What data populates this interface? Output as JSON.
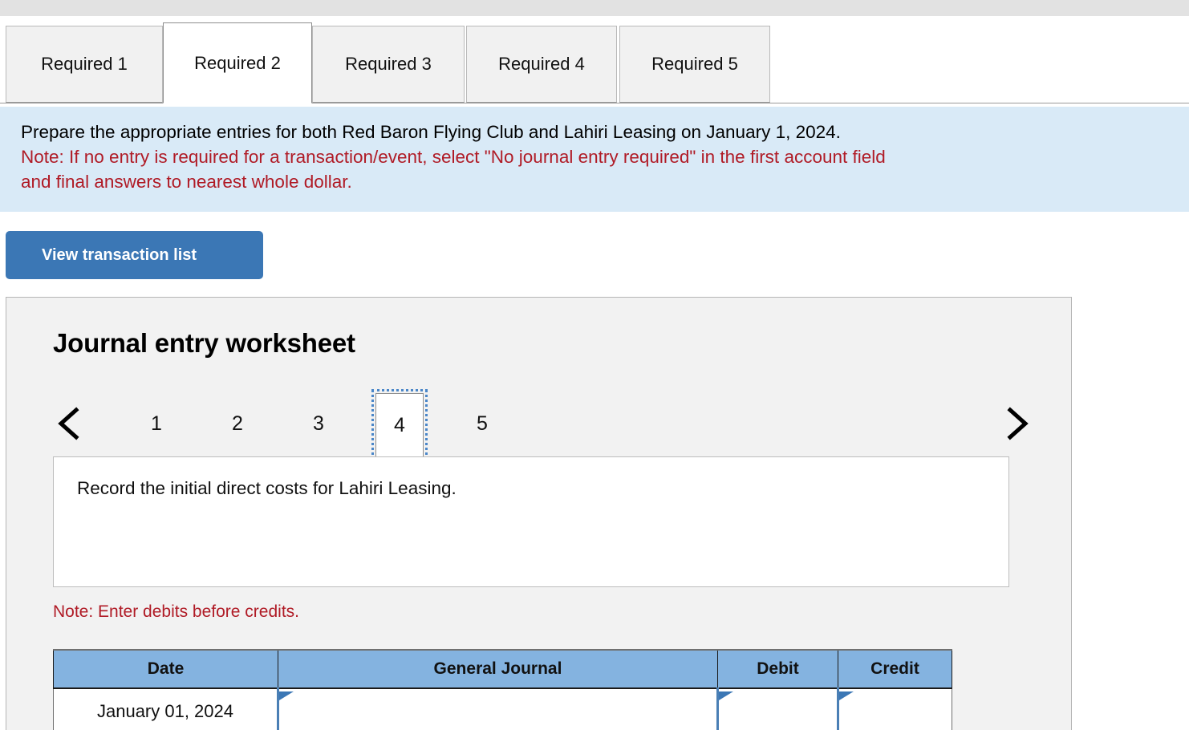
{
  "tabs": [
    {
      "label": "Required 1",
      "active": false
    },
    {
      "label": "Required 2",
      "active": true
    },
    {
      "label": "Required 3",
      "active": false
    },
    {
      "label": "Required 4",
      "active": false
    },
    {
      "label": "Required 5",
      "active": false
    }
  ],
  "banner": {
    "instruction": "Prepare the appropriate entries for both Red Baron Flying Club and Lahiri Leasing on January 1, 2024.",
    "note_line1": "Note: If no entry is required for a transaction/event, select \"No journal entry required\" in the first account field",
    "note_line2": "and final answers to nearest whole dollar."
  },
  "toolbar": {
    "view_transaction_list_label": "View transaction list"
  },
  "worksheet": {
    "title": "Journal entry worksheet",
    "pager": {
      "prev_icon": "chevron-left-icon",
      "next_icon": "chevron-right-icon",
      "pages": [
        "1",
        "2",
        "3",
        "4",
        "5"
      ],
      "selected": "4"
    },
    "description": "Record the initial direct costs for Lahiri Leasing.",
    "debits_note": "Note: Enter debits before credits.",
    "table": {
      "headers": [
        "Date",
        "General Journal",
        "Debit",
        "Credit"
      ],
      "rows": [
        {
          "date": "January 01, 2024",
          "general_journal": "",
          "debit": "",
          "credit": ""
        }
      ]
    }
  },
  "colors": {
    "banner_bg": "#d9eaf7",
    "note_red": "#b01b26",
    "button_blue": "#3b77b5",
    "table_header_blue": "#84b3e0",
    "focus_outline_blue": "#4a86c8",
    "panel_bg": "#f2f2f2",
    "top_strip_gray": "#e2e2e2"
  }
}
